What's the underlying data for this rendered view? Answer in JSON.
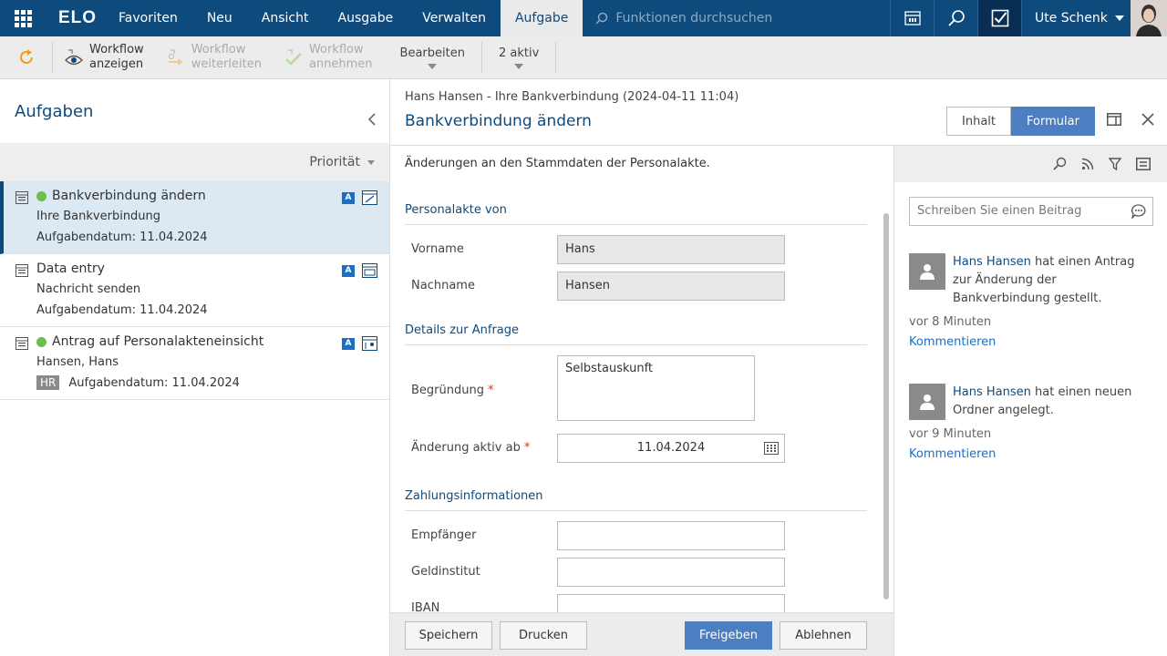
{
  "topbar": {
    "logo": "ELO",
    "menu": [
      "Favoriten",
      "Neu",
      "Ansicht",
      "Ausgabe",
      "Verwalten",
      "Aufgabe"
    ],
    "search_placeholder": "Funktionen durchsuchen",
    "user_name": "Ute Schenk"
  },
  "toolbar": {
    "show_workflow": [
      "Workflow",
      "anzeigen"
    ],
    "forward_workflow": [
      "Workflow",
      "weiterleiten"
    ],
    "accept_workflow": [
      "Workflow",
      "annehmen"
    ],
    "edit": "Bearbeiten",
    "active": "2 aktiv"
  },
  "left": {
    "title": "Aufgaben",
    "sort_label": "Priorität",
    "tasks": [
      {
        "title": "Bankverbindung ändern",
        "sub": "Ihre Bankverbindung",
        "date": "Aufgabendatum: 11.04.2024",
        "badge": "A",
        "green": true
      },
      {
        "title": "Data entry",
        "sub": "Nachricht senden",
        "date": "Aufgabendatum: 11.04.2024",
        "badge": "A",
        "green": false
      },
      {
        "title": "Antrag auf Personalakteneinsicht",
        "sub": "Hansen, Hans",
        "date": "Aufgabendatum: 11.04.2024",
        "badge": "A",
        "tag": "HR",
        "green": true
      }
    ]
  },
  "center": {
    "breadcrumb": "Hans Hansen - Ihre Bankverbindung (2024-04-11 11:04)",
    "title": "Bankverbindung ändern",
    "description": "Änderungen an den Stammdaten der Personalakte.",
    "section1": "Personalakte von",
    "vorname_label": "Vorname",
    "vorname_value": "Hans",
    "nachname_label": "Nachname",
    "nachname_value": "Hansen",
    "section2": "Details zur Anfrage",
    "begruendung_label": "Begründung",
    "begruendung_value": "Selbstauskunft",
    "aktiv_label": "Änderung aktiv ab",
    "aktiv_value": "11.04.2024",
    "required_mark": "*",
    "section3": "Zahlungsinformationen",
    "empfaenger_label": "Empfänger",
    "geldinstitut_label": "Geldinstitut",
    "iban_label": "IBAN",
    "buttons": {
      "save": "Speichern",
      "print": "Drucken",
      "release": "Freigeben",
      "reject": "Ablehnen"
    }
  },
  "viewtabs": {
    "content": "Inhalt",
    "form": "Formular"
  },
  "feed": {
    "post_placeholder": "Schreiben Sie einen Beitrag",
    "items": [
      {
        "who": "Hans Hansen",
        "text": " hat einen Antrag zur Änderung der Bankverbindung gestellt.",
        "time": "vor 8 Minuten",
        "comment": "Kommentieren"
      },
      {
        "who": "Hans Hansen",
        "text": " hat einen neuen Ordner angelegt.",
        "time": "vor 9 Minuten",
        "comment": "Kommentieren"
      }
    ]
  },
  "colors": {
    "brand": "#0f4a7d",
    "accent": "#4b7fc1",
    "status_green": "#6cbf4b",
    "refresh": "#f39c12"
  }
}
